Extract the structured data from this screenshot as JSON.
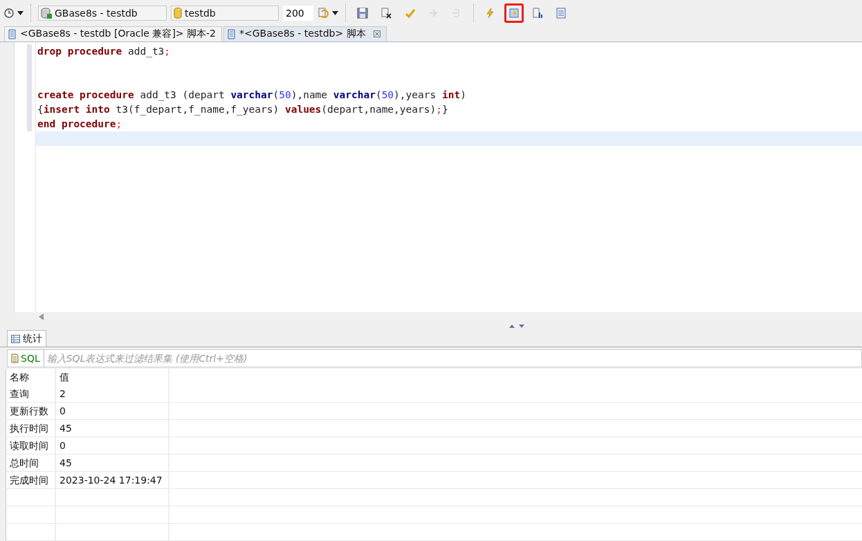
{
  "toolbar": {
    "connection": "GBase8s - testdb",
    "database": "testdb",
    "limit": "200",
    "tool_groups": [
      [
        {
          "kind": "save",
          "disabled": false,
          "highlighted": false
        },
        {
          "kind": "close-doc",
          "disabled": false,
          "highlighted": false
        },
        {
          "kind": "commit",
          "disabled": false,
          "highlighted": false
        },
        {
          "kind": "rollback",
          "disabled": true,
          "highlighted": false
        },
        {
          "kind": "revert",
          "disabled": true,
          "highlighted": false
        }
      ],
      [
        {
          "kind": "execute",
          "disabled": false,
          "highlighted": false
        },
        {
          "kind": "execute-script",
          "disabled": false,
          "highlighted": true
        },
        {
          "kind": "explain",
          "disabled": false,
          "highlighted": false
        },
        {
          "kind": "format",
          "disabled": false,
          "highlighted": false
        }
      ]
    ]
  },
  "editor_tabs": [
    {
      "label": "<GBase8s - testdb [Oracle 兼容]> 脚本-2",
      "selected": false
    },
    {
      "label": "*<GBase8s - testdb> 脚本",
      "selected": true
    }
  ],
  "editor": {
    "lines": [
      {
        "kind": "code",
        "tokens": [
          {
            "text": "drop ",
            "kind": "kw"
          },
          {
            "text": "procedure",
            "kind": "kw"
          },
          {
            "text": " add_t3",
            "kind": "plain"
          },
          {
            "text": ";",
            "kind": "punct"
          }
        ]
      },
      {
        "kind": "blank"
      },
      {
        "kind": "blank"
      },
      {
        "kind": "code",
        "tokens": [
          {
            "text": "create ",
            "kind": "kw"
          },
          {
            "text": "procedure",
            "kind": "kw"
          },
          {
            "text": " add_t3 (depart ",
            "kind": "plain"
          },
          {
            "text": "varchar",
            "kind": "type"
          },
          {
            "text": "(",
            "kind": "plain"
          },
          {
            "text": "50",
            "kind": "num"
          },
          {
            "text": "),name ",
            "kind": "plain"
          },
          {
            "text": "varchar",
            "kind": "type"
          },
          {
            "text": "(",
            "kind": "plain"
          },
          {
            "text": "50",
            "kind": "num"
          },
          {
            "text": "),years ",
            "kind": "plain"
          },
          {
            "text": "int",
            "kind": "kw"
          },
          {
            "text": ")",
            "kind": "plain"
          }
        ]
      },
      {
        "kind": "code",
        "tokens": [
          {
            "text": "{",
            "kind": "plain"
          },
          {
            "text": "insert ",
            "kind": "kw"
          },
          {
            "text": "into",
            "kind": "kw"
          },
          {
            "text": " t3(f_depart,f_name,f_years) ",
            "kind": "plain"
          },
          {
            "text": "values",
            "kind": "kw"
          },
          {
            "text": "(depart,name,years)",
            "kind": "plain"
          },
          {
            "text": ";",
            "kind": "punct"
          },
          {
            "text": "}",
            "kind": "plain"
          }
        ]
      },
      {
        "kind": "code",
        "tokens": [
          {
            "text": "end ",
            "kind": "kw"
          },
          {
            "text": "procedure",
            "kind": "kw"
          },
          {
            "text": ";",
            "kind": "punct"
          }
        ]
      },
      {
        "kind": "cursor"
      }
    ]
  },
  "results": {
    "tab": "统计",
    "filter": {
      "button": "SQL",
      "placeholder": "输入SQL表达式来过滤结果集 (使用Ctrl+空格)"
    },
    "columns": [
      "名称",
      "值"
    ],
    "rows": [
      [
        "查询",
        "2"
      ],
      [
        "更新行数",
        "0"
      ],
      [
        "执行时间",
        "45"
      ],
      [
        "读取时间",
        "0"
      ],
      [
        "总时间",
        "45"
      ],
      [
        "完成时间",
        "2023-10-24 17:19:47"
      ]
    ]
  }
}
